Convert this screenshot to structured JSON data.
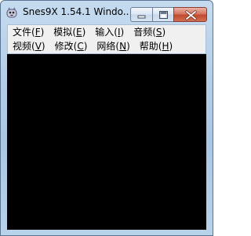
{
  "window": {
    "title": "Snes9X 1.54.1 Windo...",
    "app_icon": "snes9x-icon"
  },
  "caption_buttons": {
    "minimize_icon": "minimize-icon",
    "maximize_icon": "maximize-icon",
    "close_icon": "close-icon"
  },
  "menu": {
    "row1": [
      {
        "label": "文件",
        "key": "F"
      },
      {
        "label": "模拟",
        "key": "E"
      },
      {
        "label": "输入",
        "key": "I"
      },
      {
        "label": "音频",
        "key": "S"
      }
    ],
    "row2": [
      {
        "label": "视频",
        "key": "V"
      },
      {
        "label": "修改",
        "key": "C"
      },
      {
        "label": "网络",
        "key": "N"
      },
      {
        "label": "帮助",
        "key": "H"
      }
    ]
  },
  "colors": {
    "frame_blue": "#b6cfe8",
    "close_red": "#c14a2f",
    "viewport": "#000000"
  }
}
